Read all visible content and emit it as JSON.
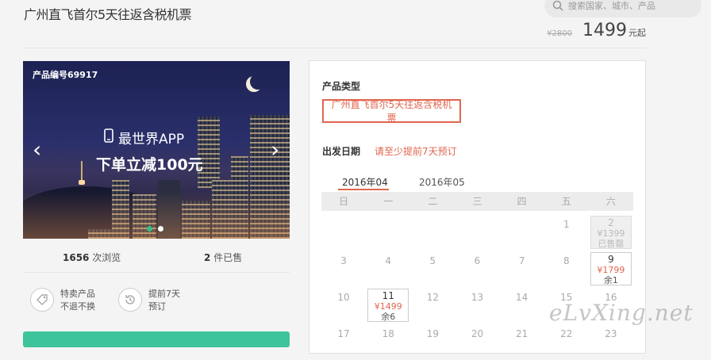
{
  "header": {
    "title": "广州直飞首尔5天往返含税机票",
    "search_placeholder": "搜索国家、城市、产品",
    "old_price": "¥2800",
    "price": "1499",
    "price_unit": "元起"
  },
  "banner": {
    "product_no": "产品编号69917",
    "promo_line1": "最世界APP",
    "promo_line2": "下单立减100元",
    "slides": 2,
    "active_slide": 1
  },
  "stats": {
    "views_count": "1656",
    "views_label": "次浏览",
    "sold_count": "2",
    "sold_label": "件已售"
  },
  "features": [
    {
      "line1": "特卖产品",
      "line2": "不退不换",
      "icon": "tag-icon"
    },
    {
      "line1": "提前7天",
      "line2": "预订",
      "icon": "clock-history-icon"
    }
  ],
  "panel": {
    "type_label": "产品类型",
    "type_option": "广州直飞首尔5天往返含税机票",
    "date_label": "出发日期",
    "date_hint": "请至少提前7天预订",
    "months": [
      "2016年04",
      "2016年05"
    ],
    "weekdays": [
      "日",
      "一",
      "二",
      "三",
      "四",
      "五",
      "六"
    ],
    "calendar_rows": [
      [
        {
          "d": ""
        },
        {
          "d": ""
        },
        {
          "d": ""
        },
        {
          "d": ""
        },
        {
          "d": ""
        },
        {
          "d": "1"
        },
        {
          "d": "2",
          "price": "¥1399",
          "remain": "已售罄",
          "sold": true
        }
      ],
      [
        {
          "d": "3"
        },
        {
          "d": "4"
        },
        {
          "d": "5"
        },
        {
          "d": "6"
        },
        {
          "d": "7"
        },
        {
          "d": "8"
        },
        {
          "d": "9",
          "price": "¥1799",
          "remain": "余1"
        }
      ],
      [
        {
          "d": "10"
        },
        {
          "d": "11",
          "price": "¥1499",
          "remain": "余6"
        },
        {
          "d": "12"
        },
        {
          "d": "13"
        },
        {
          "d": "14"
        },
        {
          "d": "15"
        },
        {
          "d": "16"
        }
      ],
      [
        {
          "d": "17"
        },
        {
          "d": "18"
        },
        {
          "d": "19"
        },
        {
          "d": "20"
        },
        {
          "d": "21"
        },
        {
          "d": "22"
        },
        {
          "d": "23"
        }
      ]
    ]
  },
  "watermark": "eLvXing.net"
}
